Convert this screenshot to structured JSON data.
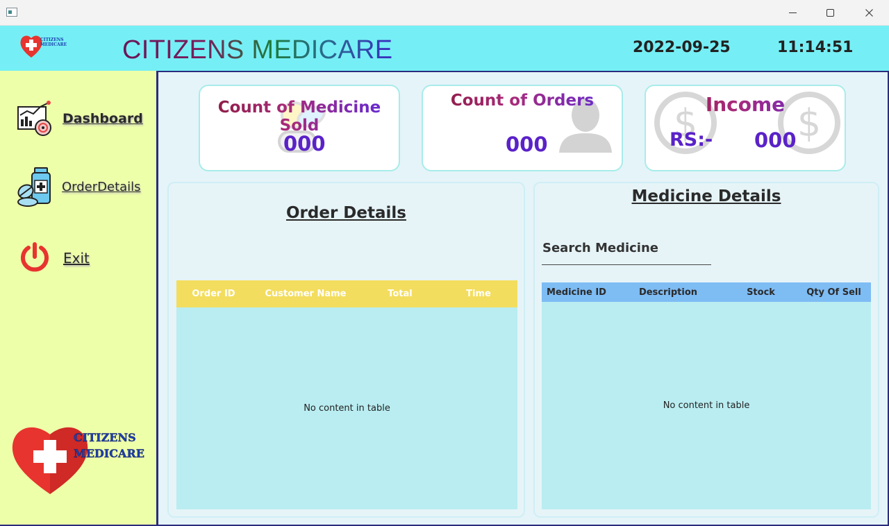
{
  "header": {
    "title": "CITIZENS MEDICARE",
    "date": "2022-09-25",
    "time": "11:14:51",
    "logo_text": [
      "CITIZENS",
      "MEDICARE"
    ]
  },
  "sidebar": {
    "items": [
      {
        "label": "Dashboard",
        "icon": "dashboard-chart-icon"
      },
      {
        "label": "OrderDetails",
        "icon": "medicine-bottle-icon"
      },
      {
        "label": "Exit",
        "icon": "power-icon"
      }
    ],
    "logo_text": [
      "CITIZENS",
      "MEDICARE"
    ]
  },
  "cards": [
    {
      "title": "Count of Medicine Sold",
      "value": "000",
      "icon": "pills-icon"
    },
    {
      "title": "Count of Orders",
      "value": "000",
      "icon": "person-icon"
    },
    {
      "title": "Income",
      "prefix": "RS:-",
      "value": "000",
      "icon": "dollar-coin-icon"
    }
  ],
  "orders_panel": {
    "title": "Order Details",
    "columns": [
      "Order ID",
      "Customer Name",
      "Total",
      "Time"
    ],
    "empty_message": "No content in table"
  },
  "medicine_panel": {
    "title": "Medicine Details",
    "search_label": "Search Medicine",
    "columns": [
      "Medicine ID",
      "Description",
      "Stock",
      "Qty Of Sell"
    ],
    "empty_message": "No content in table"
  },
  "colors": {
    "header_bg": "#75eff5",
    "sidebar_bg": "#eeffa9",
    "main_bg": "#e5f4f8",
    "orders_header": "#f3dd5e",
    "medicine_header": "#7ebcf4",
    "table_body": "#b9edf1",
    "value_purple": "#5a22c8"
  }
}
